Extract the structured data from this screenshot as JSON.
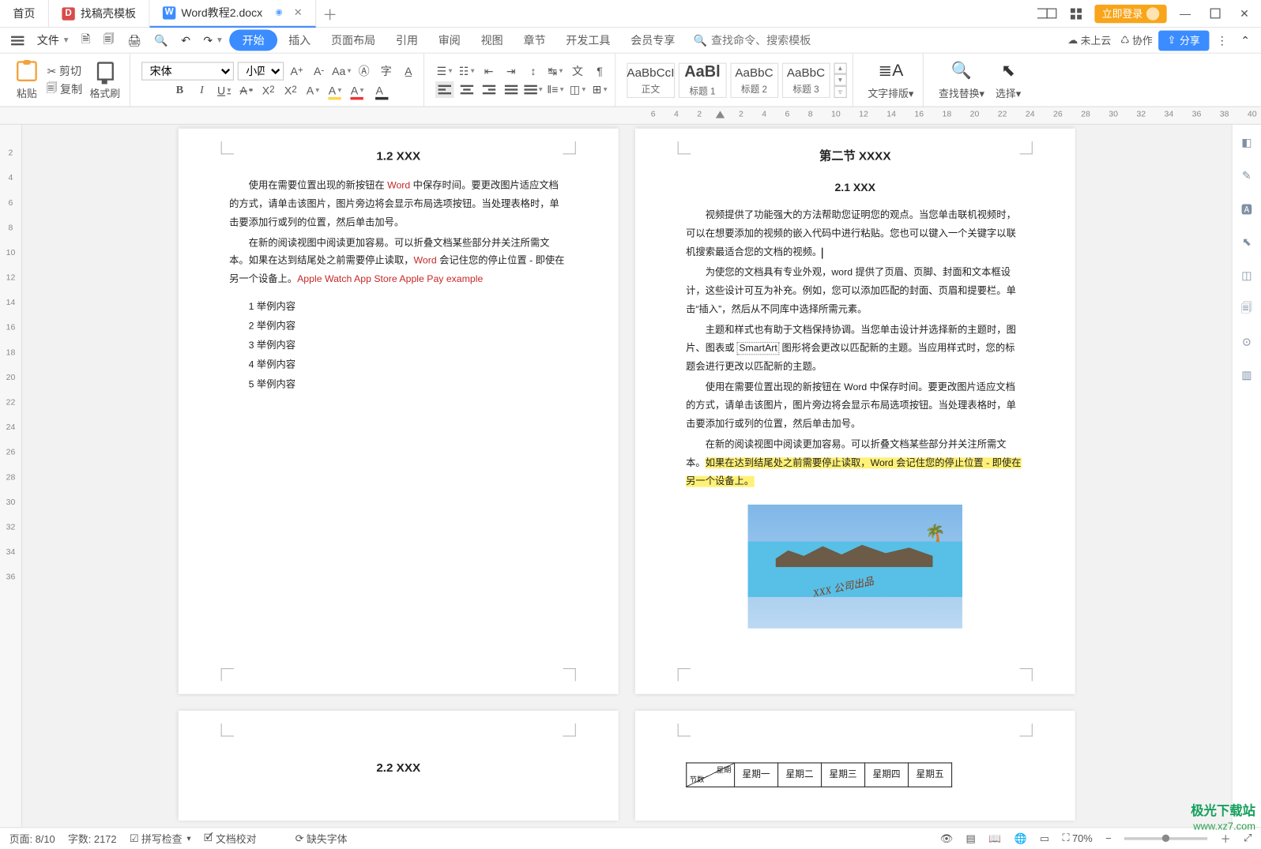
{
  "tabs": {
    "home": "首页",
    "template": {
      "label": "找稿壳模板",
      "logo_bg": "#d94b4b"
    },
    "doc": {
      "label": "Word教程2.docx",
      "logo_bg": "#3b8cff",
      "logo_text": "W"
    },
    "save_indicator": "◉"
  },
  "title_right": {
    "login": "立即登录"
  },
  "menu": {
    "file": "文件",
    "tabs": [
      "开始",
      "插入",
      "页面布局",
      "引用",
      "审阅",
      "视图",
      "章节",
      "开发工具",
      "会员专享"
    ],
    "search_placeholder": "查找命令、搜索模板",
    "cloud": "未上云",
    "coop": "协作",
    "share": "分享"
  },
  "ribbon": {
    "paste": "粘贴",
    "cut": "剪切",
    "copy": "复制",
    "format_painter": "格式刷",
    "font_name": "宋体",
    "font_size": "小四",
    "styles": [
      {
        "preview": "AaBbCcI",
        "name": "正文"
      },
      {
        "preview": "AaBl",
        "name": "标题 1"
      },
      {
        "preview": "AaBbC",
        "name": "标题 2"
      },
      {
        "preview": "AaBbC",
        "name": "标题 3"
      }
    ],
    "text_layout": "文字排版",
    "find_replace": "查找替换",
    "select": "选择"
  },
  "hruler_ticks": [
    "6",
    "4",
    "2",
    "",
    "2",
    "4",
    "6",
    "8",
    "10",
    "12",
    "14",
    "16",
    "18",
    "20",
    "22",
    "24",
    "26",
    "28",
    "30",
    "32",
    "34",
    "36",
    "38",
    "40"
  ],
  "vruler_ticks": [
    "",
    "2",
    "4",
    "6",
    "8",
    "10",
    "12",
    "14",
    "16",
    "18",
    "20",
    "22",
    "24",
    "26",
    "28",
    "30",
    "32",
    "34",
    "36"
  ],
  "doc": {
    "left": {
      "heading": "1.2 XXX",
      "p1a": "使用在需要位置出现的新按钮在 ",
      "p1b": "Word",
      "p1c": " 中保存时间。要更改图片适应文档的方式，请单击该图片，图片旁边将会显示布局选项按钮。当处理表格时，单击要添加行或列的位置，然后单击加号。",
      "p2a": "在新的阅读视图中阅读更加容易。可以折叠文档某些部分并关注所需文本。如果在达到结尾处之前需要停止读取，",
      "p2b": "Word",
      "p2c": " 会记住您的停止位置 - 即使在另一个设备上。",
      "p2d": "Apple Watch    App Store    Apple Pay    example",
      "list": [
        "举例内容",
        "举例内容",
        "举例内容",
        "举例内容",
        "举例内容"
      ]
    },
    "right": {
      "section": "第二节  XXXX",
      "heading": "2.1 XXX",
      "p1": "视频提供了功能强大的方法帮助您证明您的观点。当您单击联机视频时，可以在想要添加的视频的嵌入代码中进行粘贴。您也可以键入一个关键字以联机搜索最适合您的文档的视频。",
      "p2": "为使您的文档具有专业外观，word 提供了页眉、页脚、封面和文本框设计，这些设计可互为补充。例如，您可以添加匹配的封面、页眉和提要栏。单击“插入”，然后从不同库中选择所需元素。",
      "p3a": "主题和样式也有助于文档保持协调。当您单击设计并选择新的主题时，图片、图表或 ",
      "p3b": "SmartArt",
      "p3c": " 图形将会更改以匹配新的主题。当应用样式时，您的标题会进行更改以匹配新的主题。",
      "p4": "使用在需要位置出现的新按钮在 Word 中保存时间。要更改图片适应文档的方式，请单击该图片，图片旁边将会显示布局选项按钮。当处理表格时，单击要添加行或列的位置，然后单击加号。",
      "p5a": "在新的阅读视图中阅读更加容易。可以折叠文档某些部分并关注所需文本。",
      "p5b": "如果在达到结尾处之前需要停止读取，Word 会记住您的停止位置 - 即使在另一个设备上。",
      "stamp": "XXX 公司出品"
    },
    "page3_heading": "2.2 XXX",
    "page4_table": {
      "diag_top": "星期",
      "diag_bottom": "节数",
      "cols": [
        "星期一",
        "星期二",
        "星期三",
        "星期四",
        "星期五"
      ]
    }
  },
  "status": {
    "page": "页面: 8/10",
    "words": "字数: 2172",
    "spell": "拼写检查",
    "proof": "文档校对",
    "missing_font": "缺失字体",
    "zoom": "70%"
  },
  "watermark": {
    "brand": "极光下载站",
    "url": "www.xz7.com"
  }
}
